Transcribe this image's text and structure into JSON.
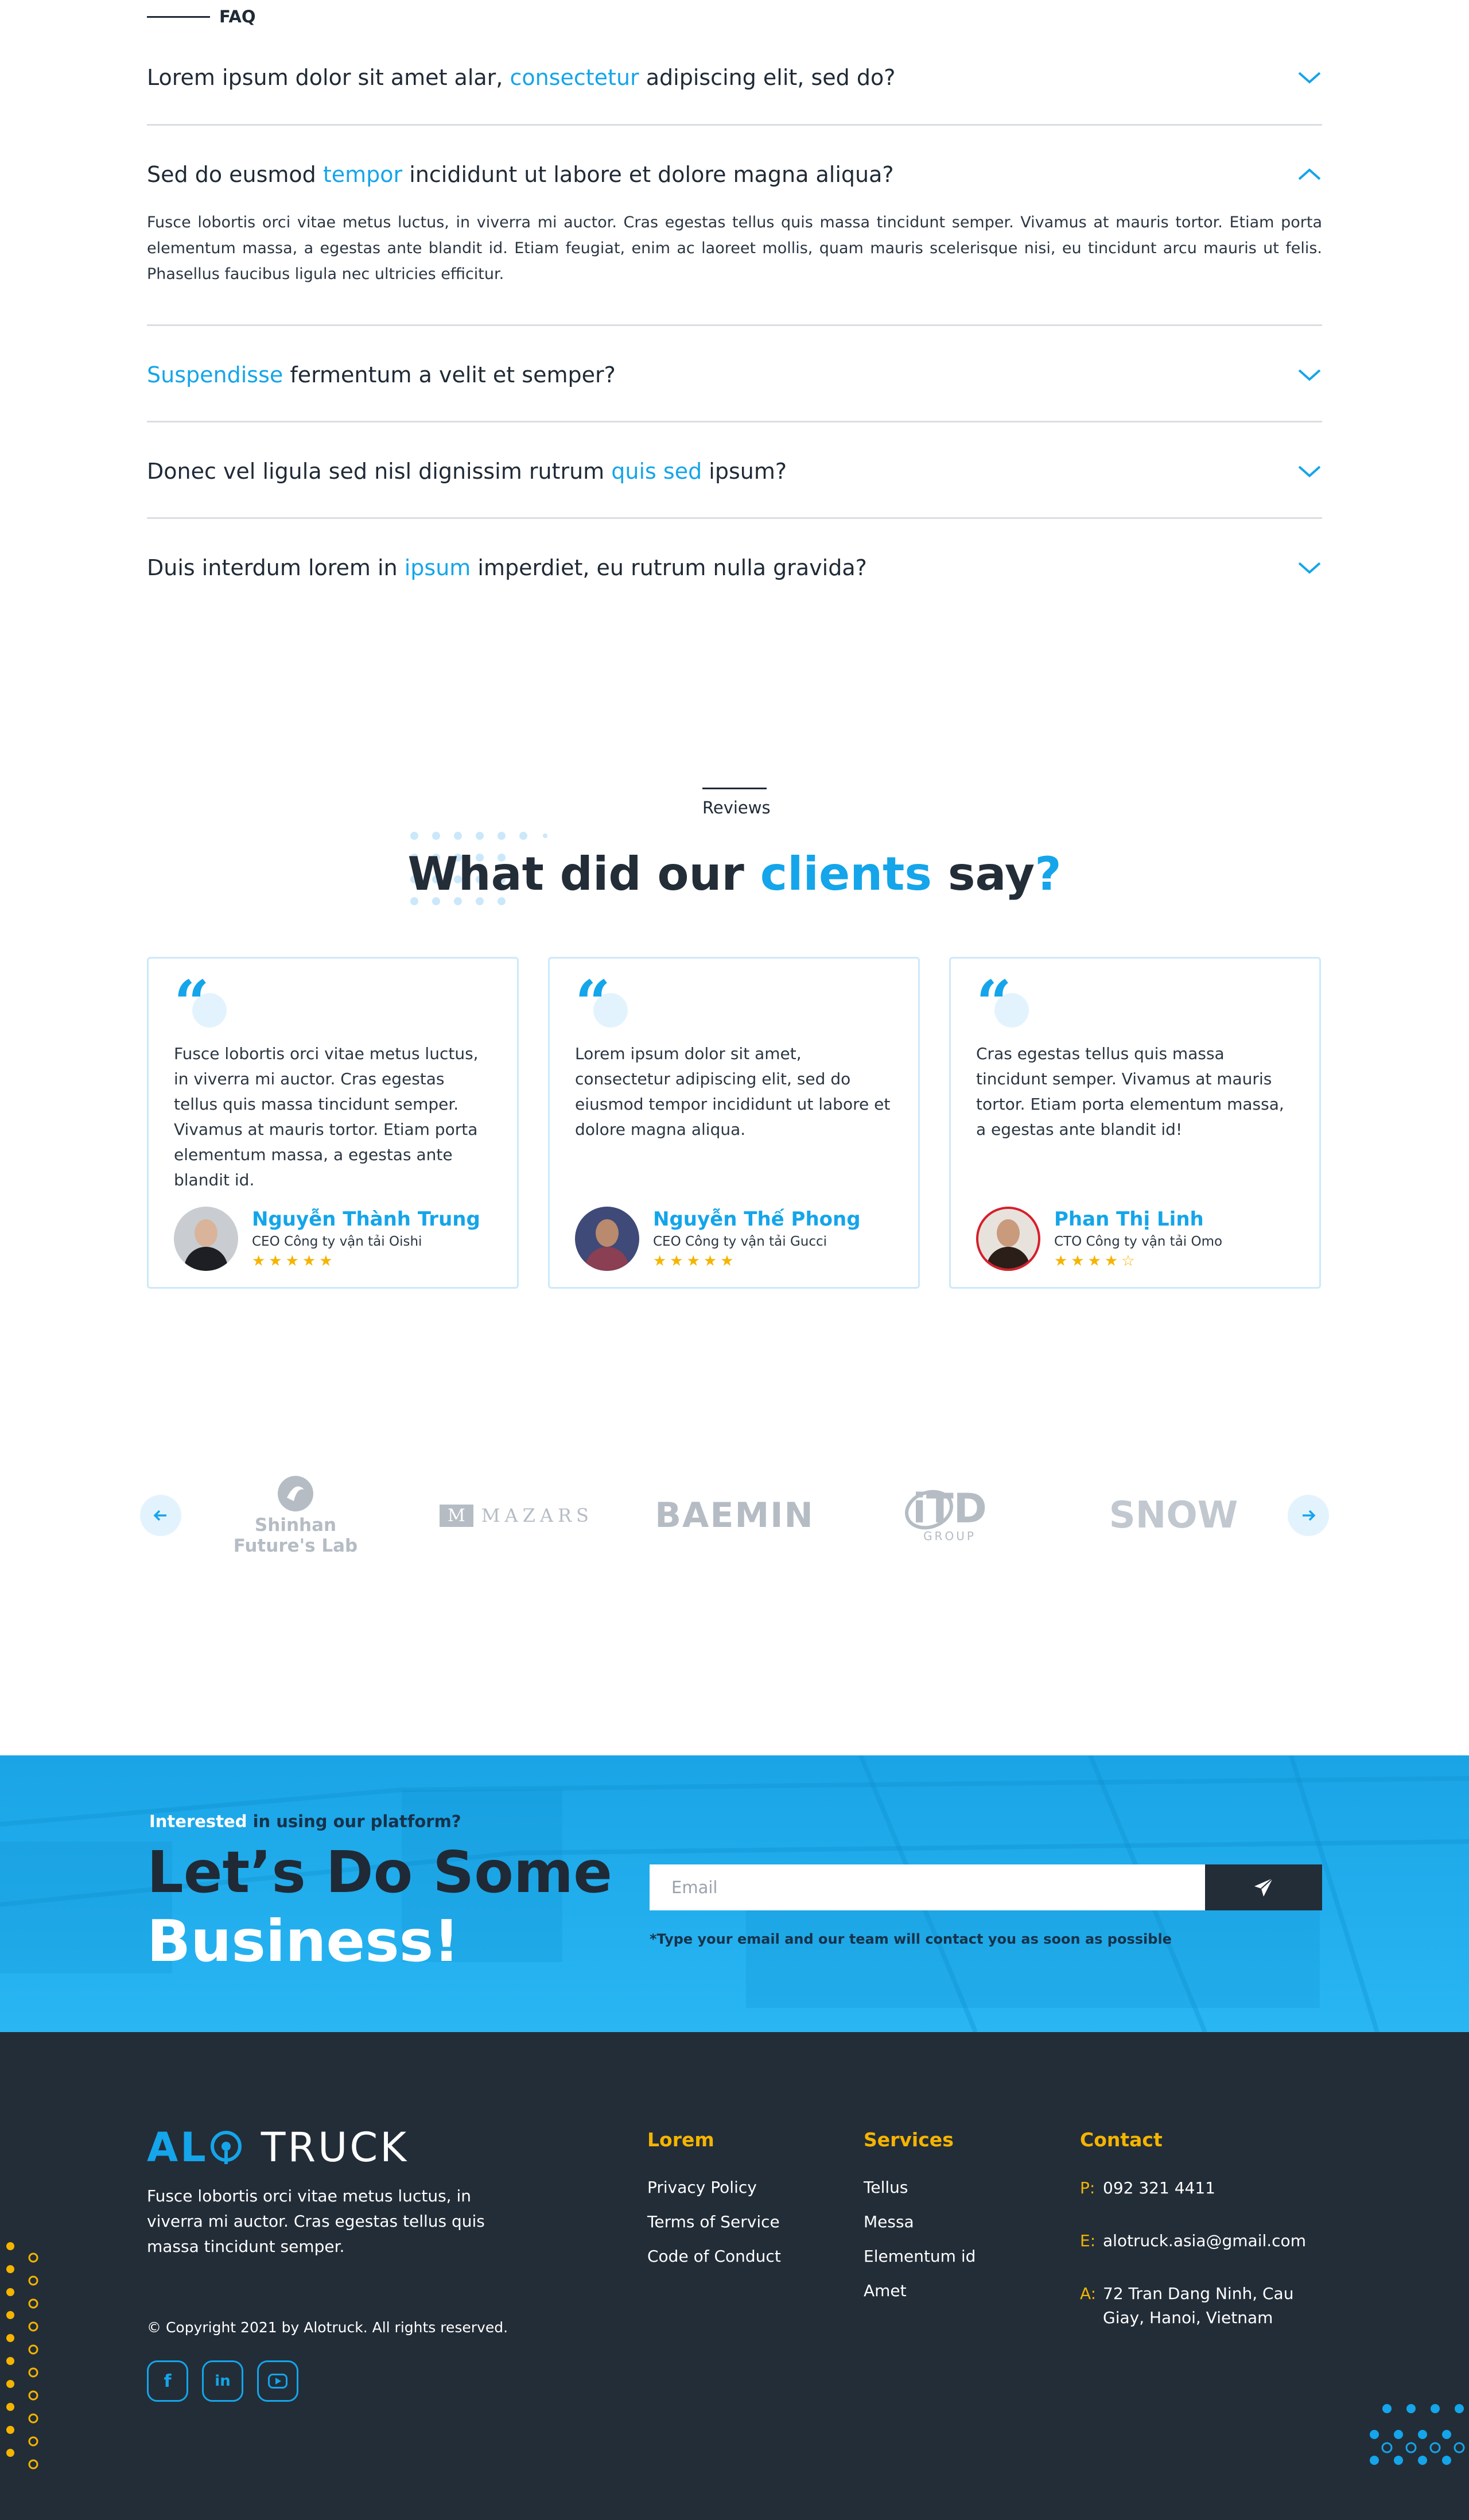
{
  "faq": {
    "eyebrow": "FAQ",
    "items": [
      {
        "pre": "Lorem ipsum dolor sit amet alar, ",
        "hl": "consectetur",
        "post": " adipiscing elit, sed do?",
        "open": false
      },
      {
        "pre": "Sed do eusmod ",
        "hl": "tempor",
        "post": " incididunt ut labore et dolore magna aliqua?",
        "open": true,
        "answer": "Fusce lobortis orci vitae metus luctus, in viverra mi auctor. Cras egestas tellus quis massa tincidunt semper. Vivamus at mauris tortor. Etiam porta elementum massa, a egestas ante blandit id. Etiam feugiat, enim ac laoreet mollis, quam mauris scelerisque nisi, eu tincidunt arcu mauris ut felis. Phasellus faucibus ligula nec ultricies efficitur."
      },
      {
        "pre": "",
        "hl": "Suspendisse",
        "post": " fermentum a velit et semper?",
        "open": false
      },
      {
        "pre": "Donec vel ligula sed nisl dignissim rutrum ",
        "hl": "quis sed",
        "post": " ipsum?",
        "open": false
      },
      {
        "pre": "Duis interdum lorem in ",
        "hl": "ipsum",
        "post": " imperdiet, eu rutrum nulla gravida?",
        "open": false
      }
    ]
  },
  "reviews": {
    "eyebrow": "Reviews",
    "title_pre": "What did our ",
    "title_hl": "clients",
    "title_post": " say",
    "title_mark": "?",
    "cards": [
      {
        "text": "Fusce lobortis orci vitae metus luctus, in viverra mi auctor. Cras egestas tellus quis massa tincidunt semper. Vivamus at mauris tortor. Etiam porta elementum massa, a egestas ante blandit id.",
        "name": "Nguyễn Thành Trung",
        "role": "CEO Công ty vận tải Oishi",
        "rating": 5
      },
      {
        "text": "Lorem ipsum dolor sit amet, consectetur adipiscing elit, sed do eiusmod tempor incididunt ut labore et dolore magna aliqua.",
        "name": "Nguyễn Thế Phong",
        "role": "CEO Công ty vận tải Gucci",
        "rating": 5
      },
      {
        "text": "Cras egestas tellus quis massa tincidunt semper. Vivamus at mauris tortor. Etiam porta elementum massa, a egestas ante blandit id!",
        "name": "Phan Thị Linh",
        "role": "CTO Công ty vận tải Omo",
        "rating": 4
      }
    ]
  },
  "partners": {
    "logos": [
      {
        "l1": "Shinhan",
        "l2": "Future's Lab"
      },
      {
        "mark": "M",
        "name": "MAZARS"
      },
      {
        "name": "BAEMIN"
      },
      {
        "name": "iTD",
        "sub": "GROUP"
      },
      {
        "name": "SNOW"
      }
    ],
    "prev_icon": "arrow-left-icon",
    "next_icon": "arrow-right-icon"
  },
  "cta": {
    "eyebrow_hl": "Interested",
    "eyebrow_rest": " in using our platform?",
    "title_line1": "Let’s Do Some",
    "title_line2": "Business!",
    "email_placeholder": "Email",
    "note": "*Type your email and our team will contact you as soon as possible"
  },
  "footer": {
    "brand_left": "AL",
    "brand_right": "TRUCK",
    "description": "Fusce lobortis orci vitae metus luctus, in viverra mi auctor. Cras egestas tellus quis massa tincidunt semper.",
    "copyright": "© Copyright 2021 by Alotruck. All rights reserved.",
    "col1": {
      "title": "Lorem",
      "links": [
        "Privacy Policy",
        "Terms of Service",
        "Code of Conduct"
      ]
    },
    "col2": {
      "title": "Services",
      "links": [
        "Tellus",
        "Messa",
        "Elementum id",
        "Amet"
      ]
    },
    "contact": {
      "title": "Contact",
      "phone_key": "P:",
      "phone": "092 321 4411",
      "email_key": "E:",
      "email": "alotruck.asia@gmail.com",
      "address_key": "A:",
      "address": "72 Tran Dang Ninh, Cau Giay, Hanoi, Vietnam"
    },
    "socials": [
      "facebook-icon",
      "linkedin-icon",
      "youtube-icon"
    ]
  },
  "colors": {
    "accent": "#14a5ea",
    "dark": "#232d38",
    "gold": "#f5b400",
    "cta_blue": "#1aa4e6"
  }
}
